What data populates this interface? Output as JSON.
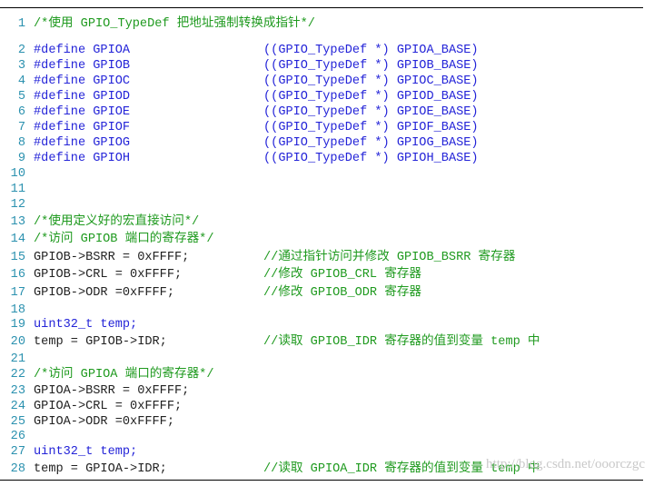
{
  "code": {
    "lines": [
      {
        "n": "1",
        "a": "/*使用 GPIO_TypeDef 把地址强制转换成指针*/",
        "ac": "c",
        "b": "",
        "bc": ""
      },
      {
        "n": "2",
        "a": "#define GPIOA",
        "ac": "k",
        "b": "((GPIO_TypeDef *) GPIOA_BASE)",
        "bc": "k"
      },
      {
        "n": "3",
        "a": "#define GPIOB",
        "ac": "k",
        "b": "((GPIO_TypeDef *) GPIOB_BASE)",
        "bc": "k"
      },
      {
        "n": "4",
        "a": "#define GPIOC",
        "ac": "k",
        "b": "((GPIO_TypeDef *) GPIOC_BASE)",
        "bc": "k"
      },
      {
        "n": "5",
        "a": "#define GPIOD",
        "ac": "k",
        "b": "((GPIO_TypeDef *) GPIOD_BASE)",
        "bc": "k"
      },
      {
        "n": "6",
        "a": "#define GPIOE",
        "ac": "k",
        "b": "((GPIO_TypeDef *) GPIOE_BASE)",
        "bc": "k"
      },
      {
        "n": "7",
        "a": "#define GPIOF",
        "ac": "k",
        "b": "((GPIO_TypeDef *) GPIOF_BASE)",
        "bc": "k"
      },
      {
        "n": "8",
        "a": "#define GPIOG",
        "ac": "k",
        "b": "((GPIO_TypeDef *) GPIOG_BASE)",
        "bc": "k"
      },
      {
        "n": "9",
        "a": "#define GPIOH",
        "ac": "k",
        "b": "((GPIO_TypeDef *) GPIOH_BASE)",
        "bc": "k"
      },
      {
        "n": "10",
        "a": "",
        "ac": "t",
        "b": "",
        "bc": ""
      },
      {
        "n": "11",
        "a": "",
        "ac": "t",
        "b": "",
        "bc": ""
      },
      {
        "n": "12",
        "a": "",
        "ac": "t",
        "b": "",
        "bc": ""
      },
      {
        "n": "13",
        "a": "/*使用定义好的宏直接访问*/",
        "ac": "c",
        "b": "",
        "bc": ""
      },
      {
        "n": "14",
        "a": "/*访问 GPIOB 端口的寄存器*/",
        "ac": "c",
        "b": "",
        "bc": ""
      },
      {
        "n": "15",
        "a": "GPIOB->BSRR = 0xFFFF;",
        "ac": "t",
        "b": "//通过指针访问并修改 GPIOB_BSRR 寄存器",
        "bc": "c"
      },
      {
        "n": "16",
        "a": "GPIOB->CRL = 0xFFFF;",
        "ac": "t",
        "b": "//修改 GPIOB_CRL 寄存器",
        "bc": "c"
      },
      {
        "n": "17",
        "a": "GPIOB->ODR =0xFFFF;",
        "ac": "t",
        "b": "//修改 GPIOB_ODR 寄存器",
        "bc": "c"
      },
      {
        "n": "18",
        "a": "",
        "ac": "t",
        "b": "",
        "bc": ""
      },
      {
        "n": "19",
        "a": "uint32_t temp;",
        "ac": "k",
        "b": "",
        "bc": ""
      },
      {
        "n": "20",
        "a": "temp = GPIOB->IDR;",
        "ac": "t",
        "b": "//读取 GPIOB_IDR 寄存器的值到变量 temp 中",
        "bc": "c"
      },
      {
        "n": "21",
        "a": "",
        "ac": "t",
        "b": "",
        "bc": ""
      },
      {
        "n": "22",
        "a": "/*访问 GPIOA 端口的寄存器*/",
        "ac": "c",
        "b": "",
        "bc": ""
      },
      {
        "n": "23",
        "a": "GPIOA->BSRR = 0xFFFF;",
        "ac": "t",
        "b": "",
        "bc": ""
      },
      {
        "n": "24",
        "a": "GPIOA->CRL = 0xFFFF;",
        "ac": "t",
        "b": "",
        "bc": ""
      },
      {
        "n": "25",
        "a": "GPIOA->ODR =0xFFFF;",
        "ac": "t",
        "b": "",
        "bc": ""
      },
      {
        "n": "26",
        "a": "",
        "ac": "t",
        "b": "",
        "bc": ""
      },
      {
        "n": "27",
        "a": "uint32_t temp;",
        "ac": "k",
        "b": "",
        "bc": ""
      },
      {
        "n": "28",
        "a": "temp = GPIOA->IDR;",
        "ac": "t",
        "b": "//读取 GPIOA_IDR 寄存器的值到变量 temp 中",
        "bc": "c"
      }
    ]
  },
  "watermark": {
    "text": "http://blog.csdn.net/ooorczgc"
  },
  "colors": {
    "keyword": "#2424d8",
    "comment": "#1f9a1f",
    "line_number": "#2b91af",
    "text": "#222222"
  }
}
